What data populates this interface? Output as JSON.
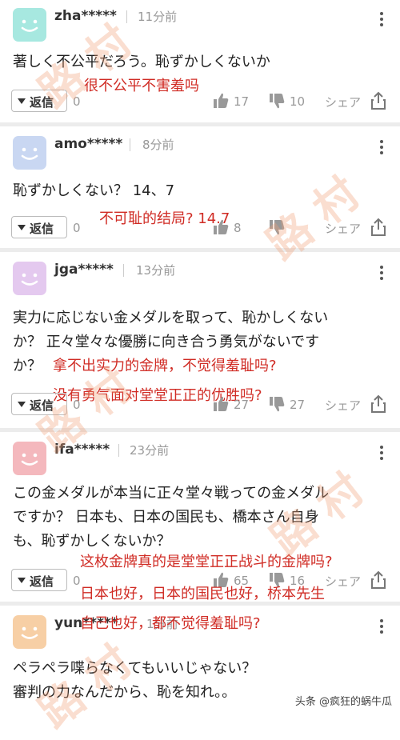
{
  "comments": [
    {
      "user": "zha*****",
      "time": "11分前",
      "text": "著しく不公平だろう。恥ずかしくないか",
      "translation": [
        "很不公平不害羞吗"
      ],
      "reply_label": "返信",
      "reply_count": "0",
      "likes": "17",
      "dislikes": "10",
      "share": "シェア",
      "avatar_color": "#a7e8e0"
    },
    {
      "user": "amo*****",
      "time": "8分前",
      "text": "恥ずかしくない？ 14、7",
      "translation": [
        "不可耻的结局? 14.7"
      ],
      "reply_label": "返信",
      "reply_count": "0",
      "likes": "8",
      "dislikes": "",
      "share": "シェア",
      "avatar_color": "#c9d7f2"
    },
    {
      "user": "jga*****",
      "time": "13分前",
      "text_lines": [
        "実力に応じない金メダルを取って、恥かしくない",
        "か？ 正々堂々な優勝に向き合う勇気がないです",
        "か？"
      ],
      "translation": [
        "拿不出实力的金牌，不觉得羞耻吗?",
        "没有勇气面对堂堂正正的优胜吗?"
      ],
      "reply_label": "返信",
      "reply_count": "0",
      "likes": "27",
      "dislikes": "27",
      "share": "シェア",
      "avatar_color": "#e4c9ef"
    },
    {
      "user": "ifa*****",
      "time": "23分前",
      "text_lines": [
        "この金メダルが本当に正々堂々戦っての金メダル",
        "ですか？ 日本も、日本の国民も、橋本さん自身",
        "も、恥ずかしくないか？"
      ],
      "translation": [
        "这枚金牌真的是堂堂正正战斗的金牌吗?",
        "日本也好，日本的国民也好，桥本先生",
        "自己也好，都不觉得羞耻吗?"
      ],
      "reply_label": "返信",
      "reply_count": "0",
      "likes": "65",
      "dislikes": "16",
      "share": "シェア",
      "avatar_color": "#f4b8bd"
    },
    {
      "user": "yun*****",
      "time": "1分前",
      "text_lines": [
        "ペラペラ喋らなくてもいいじゃない？",
        "審判の力なんだから、恥を知れ。。"
      ],
      "avatar_color": "#f7cfa5"
    }
  ],
  "watermark": "路 村",
  "footer": "头条 @疯狂的蜗牛瓜",
  "colors": {
    "translation": "#d02c25",
    "muted": "#999999"
  }
}
